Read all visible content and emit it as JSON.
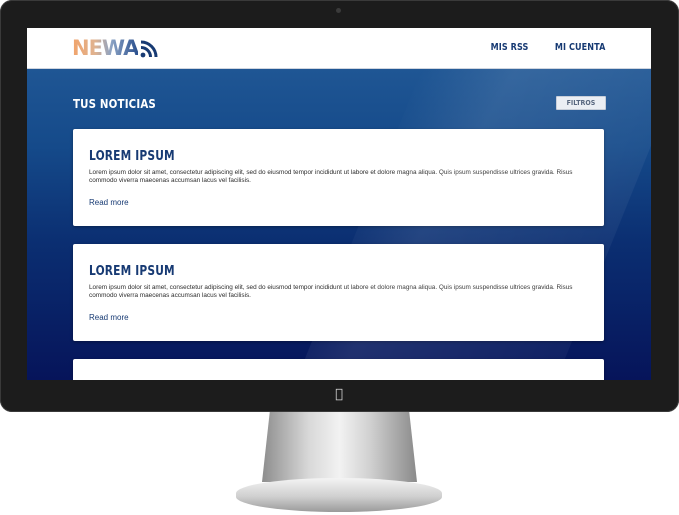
{
  "header": {
    "logo_text": "NEWA",
    "nav": [
      "MIS RSS",
      "MI CUENTA"
    ]
  },
  "main": {
    "section_title": "TUS NOTICIAS",
    "filter_label": "FILTROS",
    "articles": [
      {
        "title": "LOREM IPSUM",
        "body": "Lorem ipsum dolor sit amet, consectetur adipiscing elit, sed do eiusmod tempor incididunt ut labore et dolore magna aliqua. Quis ipsum suspendisse ultrices gravida. Risus commodo viverra maecenas accumsan lacus vel facilisis.",
        "link": "Read more"
      },
      {
        "title": "LOREM IPSUM",
        "body": "Lorem ipsum dolor sit amet, consectetur adipiscing elit, sed do eiusmod tempor incididunt ut labore et dolore magna aliqua. Quis ipsum suspendisse ultrices gravida. Risus commodo viverra maecenas accumsan lacus vel facilisis.",
        "link": "Read more"
      }
    ]
  },
  "colors": {
    "brand_navy": "#173a73",
    "background_top": "#1f5694",
    "background_bottom": "#06145a"
  },
  "icons": {
    "logo": "wifi-signal-icon",
    "monitor_badge": "apple-logo-icon"
  }
}
